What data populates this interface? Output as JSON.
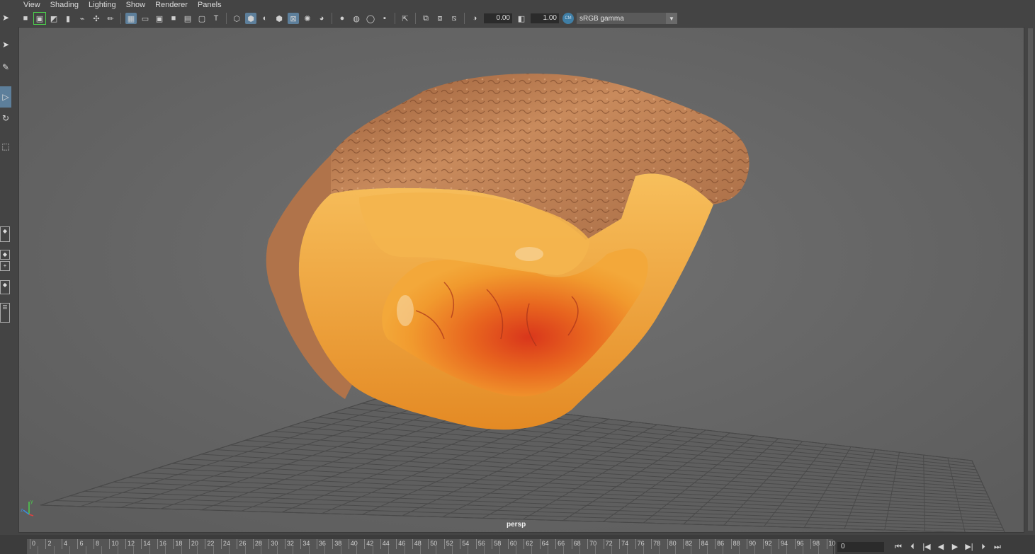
{
  "menu": [
    "View",
    "Shading",
    "Lighting",
    "Show",
    "Renderer",
    "Panels"
  ],
  "toolbar": {
    "icons": [
      "camera-icon",
      "lock-camera-icon",
      "camera-attribute-icon",
      "bookmark-icon",
      "image-plane-icon",
      "2d-pan-icon",
      "grease-pencil-icon",
      "grid-icon",
      "film-gate-icon",
      "resolution-gate-icon",
      "gate-mask-icon",
      "field-chart-icon",
      "safe-action-icon",
      "safe-title-icon",
      "wireframe-icon",
      "smooth-shade-icon",
      "default-material-icon",
      "wireframe-on-shaded-icon",
      "xray-icon",
      "use-lights-icon",
      "shadows-icon",
      "screen-space-ao-icon",
      "motion-blur-icon",
      "anti-aliasing-icon",
      "depth-of-field-icon",
      "isolate-select-icon",
      "xray-joints-icon",
      "xray-active-icon",
      "backface-culling-icon",
      "exposure-icon",
      "gamma-icon",
      "color-management-icon"
    ],
    "exposure": "0.00",
    "gamma": "1.00",
    "colorspace": "sRGB gamma"
  },
  "viewport": {
    "camera": "persp"
  },
  "timeline": {
    "ticks": [
      "0",
      "2",
      "4",
      "6",
      "8",
      "10",
      "12",
      "14",
      "16",
      "18",
      "20",
      "22",
      "24",
      "26",
      "28",
      "30",
      "32",
      "34",
      "36",
      "38",
      "40",
      "42",
      "44",
      "46",
      "48",
      "50",
      "52",
      "54",
      "56",
      "58",
      "60",
      "62",
      "64",
      "66",
      "68",
      "70",
      "72",
      "74",
      "76",
      "78",
      "80",
      "82",
      "84",
      "86",
      "88",
      "90",
      "92",
      "94",
      "96",
      "98",
      "10"
    ],
    "current_frame": "0",
    "playback_buttons": [
      "go-to-start-icon",
      "step-back-key-icon",
      "step-back-frame-icon",
      "play-backward-icon",
      "play-forward-icon",
      "step-forward-frame-icon",
      "step-forward-key-icon",
      "go-to-end-icon"
    ]
  }
}
